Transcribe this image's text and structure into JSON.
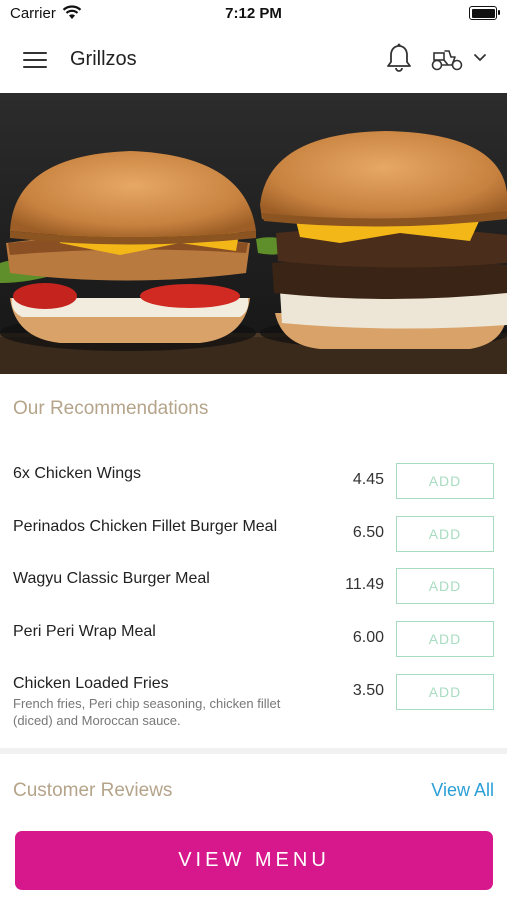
{
  "status_bar": {
    "carrier": "Carrier",
    "time": "7:12 PM"
  },
  "nav": {
    "title": "Grillzos"
  },
  "recommendations": {
    "title": "Our Recommendations",
    "items": [
      {
        "name": "6x Chicken Wings",
        "desc": "",
        "price": "4.45",
        "add_label": "ADD"
      },
      {
        "name": "Perinados Chicken Fillet Burger Meal",
        "desc": "",
        "price": "6.50",
        "add_label": "ADD"
      },
      {
        "name": "Wagyu Classic Burger Meal",
        "desc": "",
        "price": "11.49",
        "add_label": "ADD"
      },
      {
        "name": "Peri Peri Wrap Meal",
        "desc": "",
        "price": "6.00",
        "add_label": "ADD"
      },
      {
        "name": "Chicken Loaded Fries",
        "desc": "French fries, Peri chip seasoning, chicken fillet (diced) and Moroccan sauce.",
        "price": "3.50",
        "add_label": "ADD"
      }
    ]
  },
  "reviews": {
    "title": "Customer Reviews",
    "view_all": "View All"
  },
  "cta": {
    "view_menu": "VIEW MENU"
  },
  "colors": {
    "brand": "#d6188c",
    "section_title": "#b5a48a",
    "add_outline": "#a8dcc0",
    "link": "#2a9fd6"
  },
  "icons": [
    "menu-icon",
    "bell-icon",
    "delivery-scooter-icon",
    "chevron-down-icon",
    "wifi-icon",
    "battery-icon"
  ]
}
